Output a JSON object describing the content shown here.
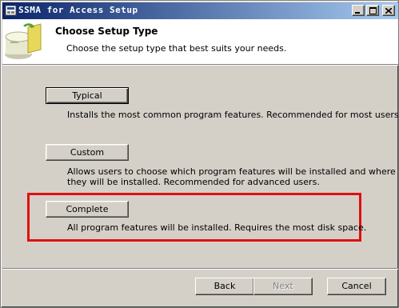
{
  "window": {
    "title": "SSMA for Access Setup"
  },
  "header": {
    "title": "Choose Setup Type",
    "subtitle": "Choose the setup type that best suits your needs.",
    "icon": "setup-package-icon"
  },
  "options": [
    {
      "label": "Typical",
      "description": "Installs the most common program features. Recommended for most users."
    },
    {
      "label": "Custom",
      "description_lines": [
        "Allows users to choose which program features will be installed and where",
        "they will be installed. Recommended for advanced users."
      ]
    },
    {
      "label": "Complete",
      "description": "All program features will be installed. Requires the most disk space."
    }
  ],
  "highlight": {
    "color": "#e01010",
    "target": "Complete"
  },
  "footer": {
    "back_label": "Back",
    "next_label": "Next",
    "cancel_label": "Cancel"
  },
  "titlebar_buttons": {
    "minimize": "minimize-icon",
    "maximize": "maximize-icon",
    "close": "close-icon"
  }
}
